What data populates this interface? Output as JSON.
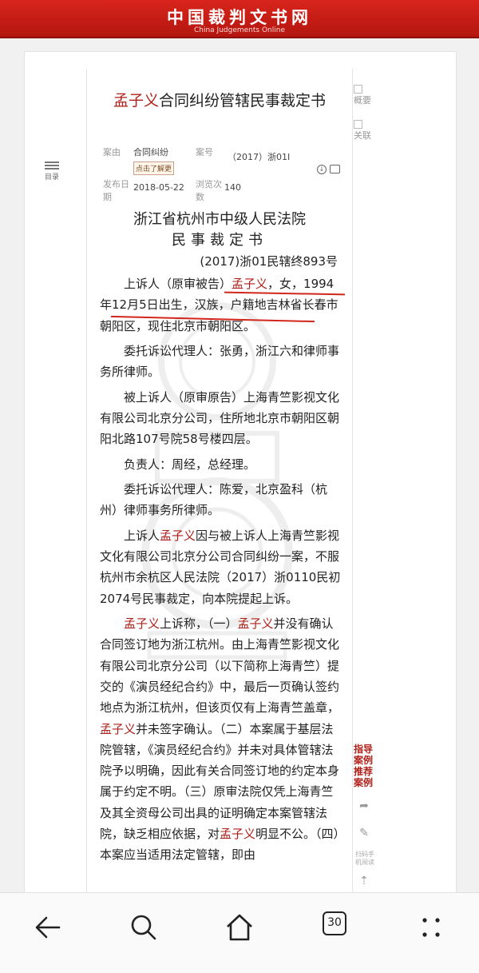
{
  "banner": {
    "title": "中国裁判文书网",
    "subtitle": "China Judgements Online"
  },
  "document": {
    "title_highlight": "孟子义",
    "title_rest": "合同纠纷管辖民事裁定书",
    "meta": {
      "case_reason_label": "案由",
      "case_reason_value": "合同纠纷",
      "explain_button": "点击了解更",
      "case_no_label": "案号",
      "case_no_value": "（2017）浙01Ⅰ",
      "publish_date_label": "发布日期",
      "publish_date_value": "2018-05-22",
      "views_label": "浏览次数",
      "views_value": "140"
    },
    "court_name": "浙江省杭州市中级人民法院",
    "doc_type": "民事裁定书",
    "case_number": "(2017)浙01民辖终893号",
    "paragraphs": [
      {
        "segments": [
          "上诉人（原审被告）",
          "孟子义",
          "，女，1994年12月5日出生，汉族，户籍地吉林省长春市朝阳区，现住北京市朝阳区。"
        ]
      },
      {
        "segments": [
          "委托诉讼代理人：张勇，浙江六和律师事务所律师。"
        ]
      },
      {
        "segments": [
          "被上诉人（原审原告）上海青竺影视文化有限公司北京分公司，住所地北京市朝阳区朝阳北路107号院58号楼四层。"
        ]
      },
      {
        "segments": [
          "负责人：周经，总经理。"
        ]
      },
      {
        "segments": [
          "委托诉讼代理人：陈爱，北京盈科（杭州）律师事务所律师。"
        ]
      },
      {
        "segments": [
          "上诉人",
          "孟子义",
          "因与被上诉人上海青竺影视文化有限公司北京分公司合同纠纷一案，不服杭州市余杭区人民法院（2017）浙0110民初2074号民事裁定，向本院提起上诉。"
        ]
      },
      {
        "segments": [
          "孟子义",
          "上诉称，（一）",
          "孟子义",
          "并没有确认合同签订地为浙江杭州。由上海青竺影视文化有限公司北京分公司（以下简称上海青竺）提交的《演员经纪合约》中，最后一页确认签约地点为浙江杭州，但该页仅有上海青竺盖章，",
          "孟子义",
          "并未签字确认。（二）本案属于基层法院管辖，《演员经纪合约》并未对具体管辖法院予以明确，因此有关合同签订地的约定本身属于约定不明。（三）原审法院仅凭上海青竺及其全资母公司出具的证明确定本案管辖法院，缺乏相应依据，对",
          "孟子义",
          "明显不公。（四）本案应当适用法定管辖，即由"
        ]
      }
    ]
  },
  "left_panel": {
    "toc_label": "目录"
  },
  "right_panel": {
    "summary_label": "概要",
    "related_label": "关联",
    "guide_lines": [
      "指导",
      "案例",
      "推荐",
      "案例"
    ],
    "scan_text": "扫码手机阅读"
  },
  "browser_nav": {
    "tabs_count": "30"
  },
  "colors": {
    "accent_red": "#b0201a",
    "banner_red": "#d2261c"
  }
}
